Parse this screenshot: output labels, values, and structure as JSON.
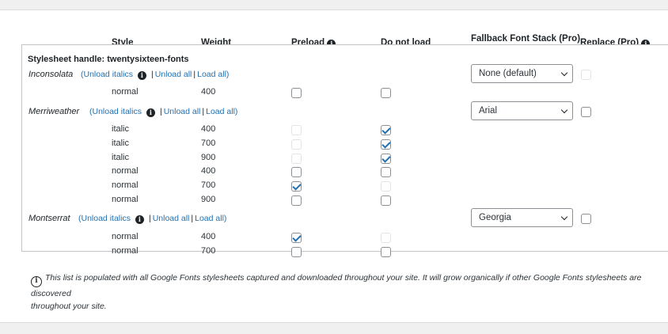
{
  "headers": {
    "style": "Style",
    "weight": "Weight",
    "preload": "Preload",
    "do_not_load": "Do not load",
    "fallback": "Fallback Font Stack (Pro)",
    "replace": "Replace (Pro)"
  },
  "stylesheet_handle": "Stylesheet handle: twentysixteen-fonts",
  "links": {
    "unload_italics": "(Unload italics",
    "unload_all": "Unload all",
    "load_all": "Load all)",
    "sep": "|"
  },
  "fonts": [
    {
      "name": "Inconsolata",
      "fallback": "None (default)",
      "replace_enabled": false,
      "variants": [
        {
          "style": "normal",
          "weight": "400",
          "preload": false,
          "preload_enabled": true,
          "do_not_load": false,
          "do_not_load_enabled": true
        }
      ]
    },
    {
      "name": "Merriweather",
      "fallback": "Arial",
      "replace_enabled": true,
      "variants": [
        {
          "style": "italic",
          "weight": "400",
          "preload": false,
          "preload_enabled": false,
          "do_not_load": true,
          "do_not_load_enabled": true
        },
        {
          "style": "italic",
          "weight": "700",
          "preload": false,
          "preload_enabled": false,
          "do_not_load": true,
          "do_not_load_enabled": true
        },
        {
          "style": "italic",
          "weight": "900",
          "preload": false,
          "preload_enabled": false,
          "do_not_load": true,
          "do_not_load_enabled": true
        },
        {
          "style": "normal",
          "weight": "400",
          "preload": false,
          "preload_enabled": true,
          "do_not_load": false,
          "do_not_load_enabled": true
        },
        {
          "style": "normal",
          "weight": "700",
          "preload": true,
          "preload_enabled": true,
          "do_not_load": false,
          "do_not_load_enabled": false
        },
        {
          "style": "normal",
          "weight": "900",
          "preload": false,
          "preload_enabled": true,
          "do_not_load": false,
          "do_not_load_enabled": true
        }
      ]
    },
    {
      "name": "Montserrat",
      "fallback": "Georgia",
      "replace_enabled": true,
      "variants": [
        {
          "style": "normal",
          "weight": "400",
          "preload": true,
          "preload_enabled": true,
          "do_not_load": false,
          "do_not_load_enabled": false
        },
        {
          "style": "normal",
          "weight": "700",
          "preload": false,
          "preload_enabled": true,
          "do_not_load": false,
          "do_not_load_enabled": true
        }
      ]
    }
  ],
  "note": "This list is populated with all Google Fonts stylesheets captured and downloaded throughout your site. It will grow organically if other Google Fonts stylesheets are discovered throughout your site.",
  "note_line1": "This list is populated with all Google Fonts stylesheets captured and downloaded throughout your site. It will grow organically if other Google Fonts stylesheets are discovered",
  "note_line2": "throughout your site.",
  "icons": {
    "info": "info-icon",
    "chevron": "chevron-down-icon"
  }
}
